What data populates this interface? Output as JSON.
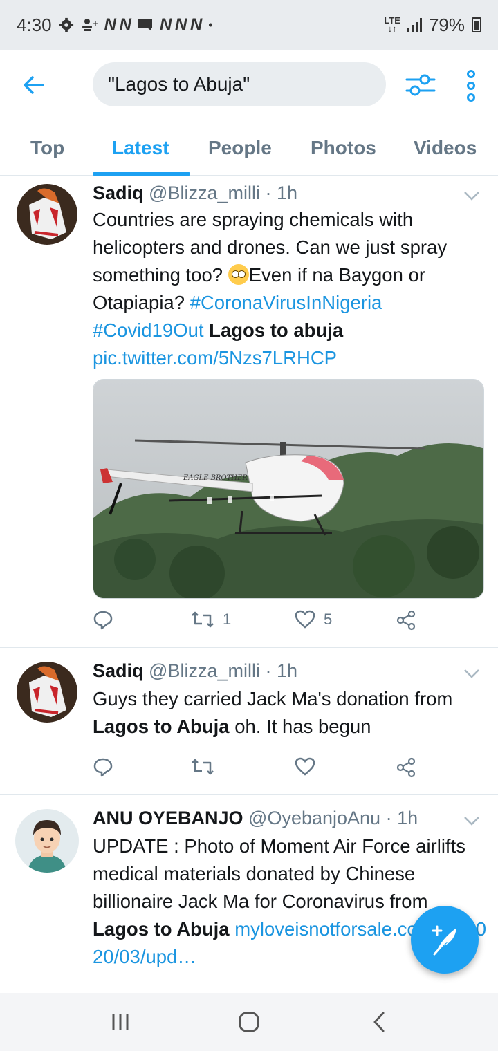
{
  "status_bar": {
    "time": "4:30",
    "notification_icons": [
      "gear-icon",
      "person-add-icon",
      "N",
      "N",
      "message-icon",
      "N",
      "N",
      "N",
      "dot"
    ],
    "network": "LTE",
    "battery": "79%"
  },
  "header": {
    "search_query": "\"Lagos to Abuja\"",
    "back_icon": "arrow-left-icon",
    "filter_icon": "sliders-icon",
    "more_icon": "more-vertical-icon"
  },
  "tabs": [
    {
      "label": "Top",
      "active": false
    },
    {
      "label": "Latest",
      "active": true
    },
    {
      "label": "People",
      "active": false
    },
    {
      "label": "Photos",
      "active": false
    },
    {
      "label": "Videos",
      "active": false
    }
  ],
  "tweets": [
    {
      "name": "Sadiq",
      "handle": "@Blizza_milli",
      "time": "· 1h",
      "text_1": "Countries are spraying chemicals with helicopters and drones. Can we just spray something too? ",
      "text_2": "Even if na Baygon or Otapiapia? ",
      "hashtag_1": "#CoronaVirusInNigeria",
      "hashtag_2": "#Covid19Out",
      "highlight": "Lagos to abuja",
      "link": "pic.twitter.com/5Nzs7LRHCP",
      "image_caption": "EAGLE BROTHER",
      "retweets": "1",
      "likes": "5"
    },
    {
      "name": "Sadiq",
      "handle": "@Blizza_milli",
      "time": "· 1h",
      "text_1": "Guys they carried Jack Ma's donation from ",
      "highlight": "Lagos to Abuja",
      "text_2": " oh. It has begun",
      "retweets": "",
      "likes": ""
    },
    {
      "name": "ANU OYEBANJO",
      "handle": "@OyebanjoAnu",
      "time": "· 1h",
      "text_1": "UPDATE : Photo of Moment Air Force airlifts medical materials donated by Chinese billionaire Jack Ma  for Coronavirus from ",
      "highlight": "Lagos to Abuja",
      "link": "myloveisnotforsale.com.ng/2020/03/upd…"
    }
  ],
  "fab": {
    "icon": "compose-tweet-icon"
  },
  "navbar": {
    "icons": [
      "recent-apps-icon",
      "home-icon",
      "back-icon"
    ]
  },
  "colors": {
    "accent": "#1da1f2",
    "link": "#1b95e0",
    "muted": "#657786"
  }
}
